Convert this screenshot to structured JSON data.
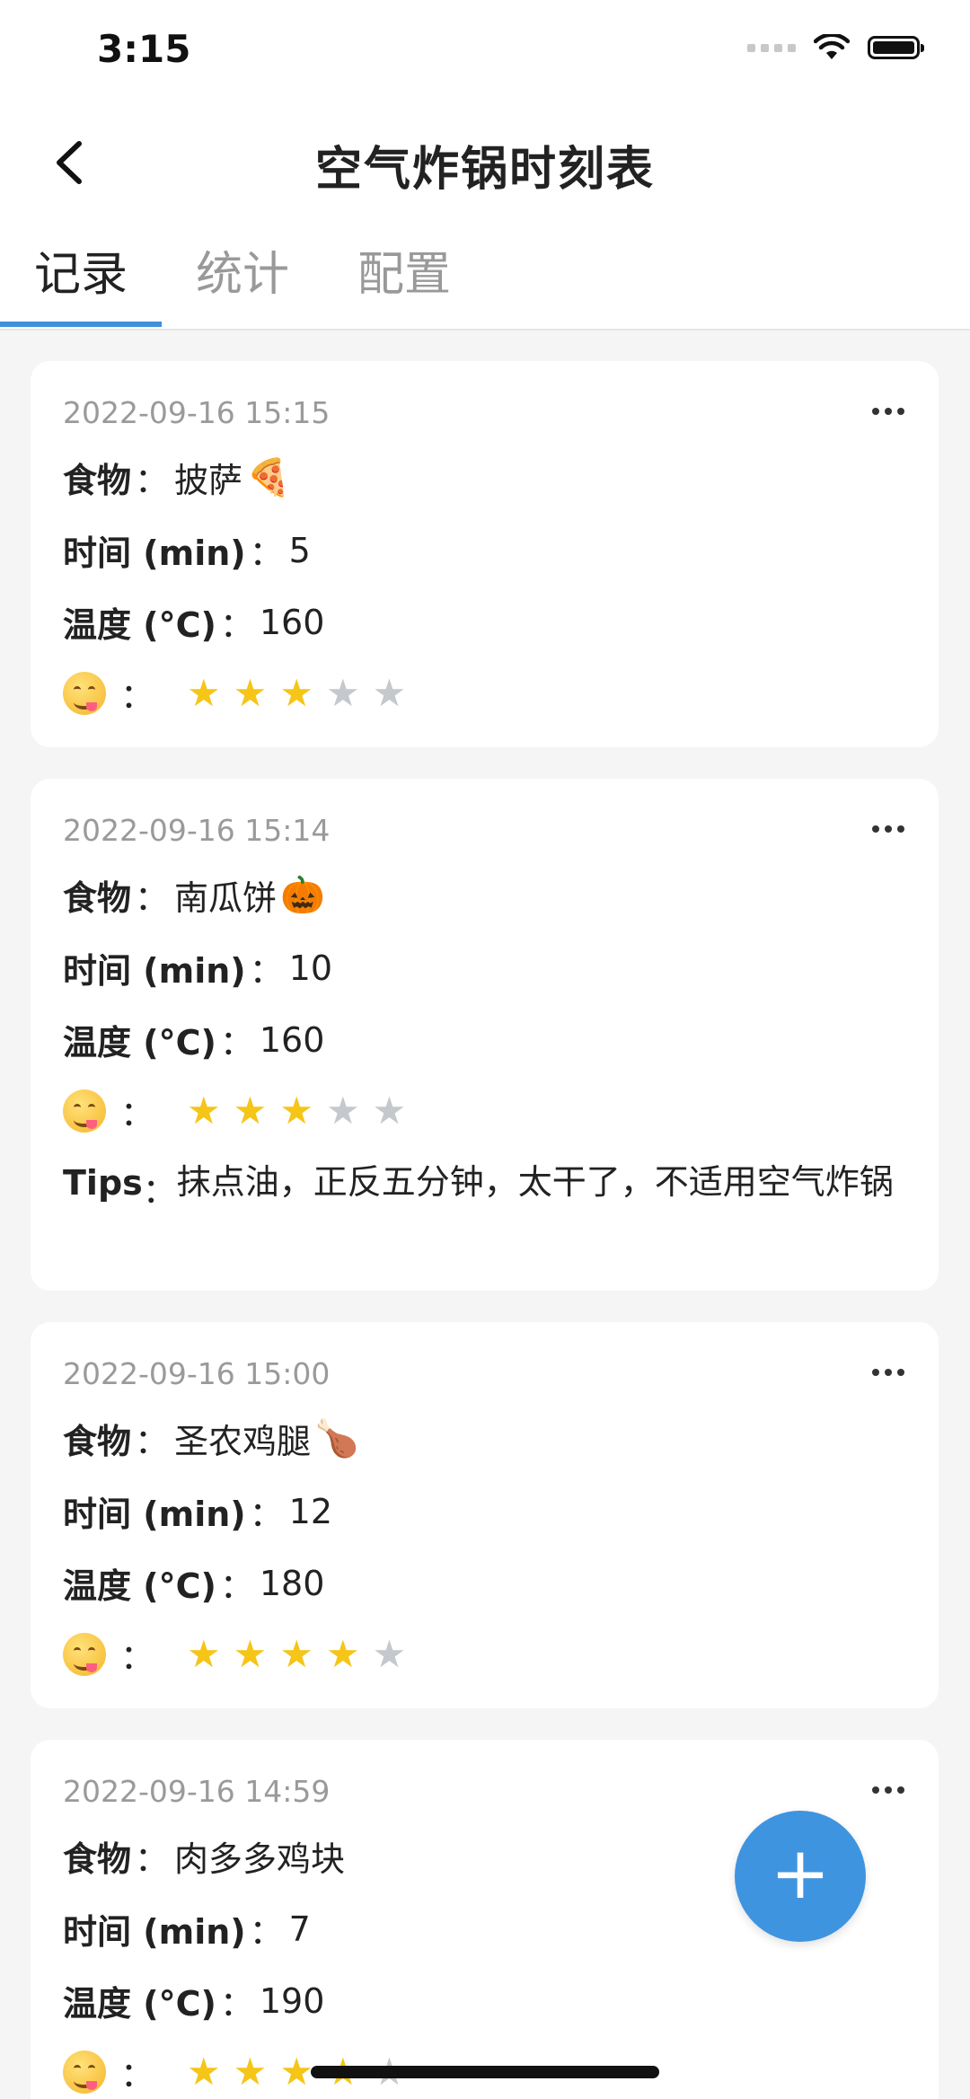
{
  "status": {
    "time": "3:15"
  },
  "nav": {
    "title": "空气炸锅时刻表"
  },
  "tabs": [
    {
      "label": "记录"
    },
    {
      "label": "统计"
    },
    {
      "label": "配置"
    }
  ],
  "labels": {
    "food": "食物",
    "time": "时间 (min)",
    "temp": "温度 (°C)",
    "tips": "Tips",
    "colon": "："
  },
  "records": [
    {
      "date": "2022-09-16 15:15",
      "food": "披萨",
      "food_emoji": "🍕",
      "time": "5",
      "temp": "160",
      "rating": 3,
      "tips": ""
    },
    {
      "date": "2022-09-16 15:14",
      "food": "南瓜饼",
      "food_emoji": "🎃",
      "time": "10",
      "temp": "160",
      "rating": 3,
      "tips": "抹点油，正反五分钟，太干了，不适用空气炸锅"
    },
    {
      "date": "2022-09-16 15:00",
      "food": "圣农鸡腿",
      "food_emoji": "🍗",
      "time": "12",
      "temp": "180",
      "rating": 4,
      "tips": ""
    },
    {
      "date": "2022-09-16 14:59",
      "food": "肉多多鸡块",
      "food_emoji": "",
      "time": "7",
      "temp": "190",
      "rating": 4,
      "tips": ""
    }
  ],
  "fab": {
    "label": "+"
  },
  "colors": {
    "accent": "#3f94e0",
    "star_on": "#f5c518",
    "star_off": "#c5c8cc"
  }
}
